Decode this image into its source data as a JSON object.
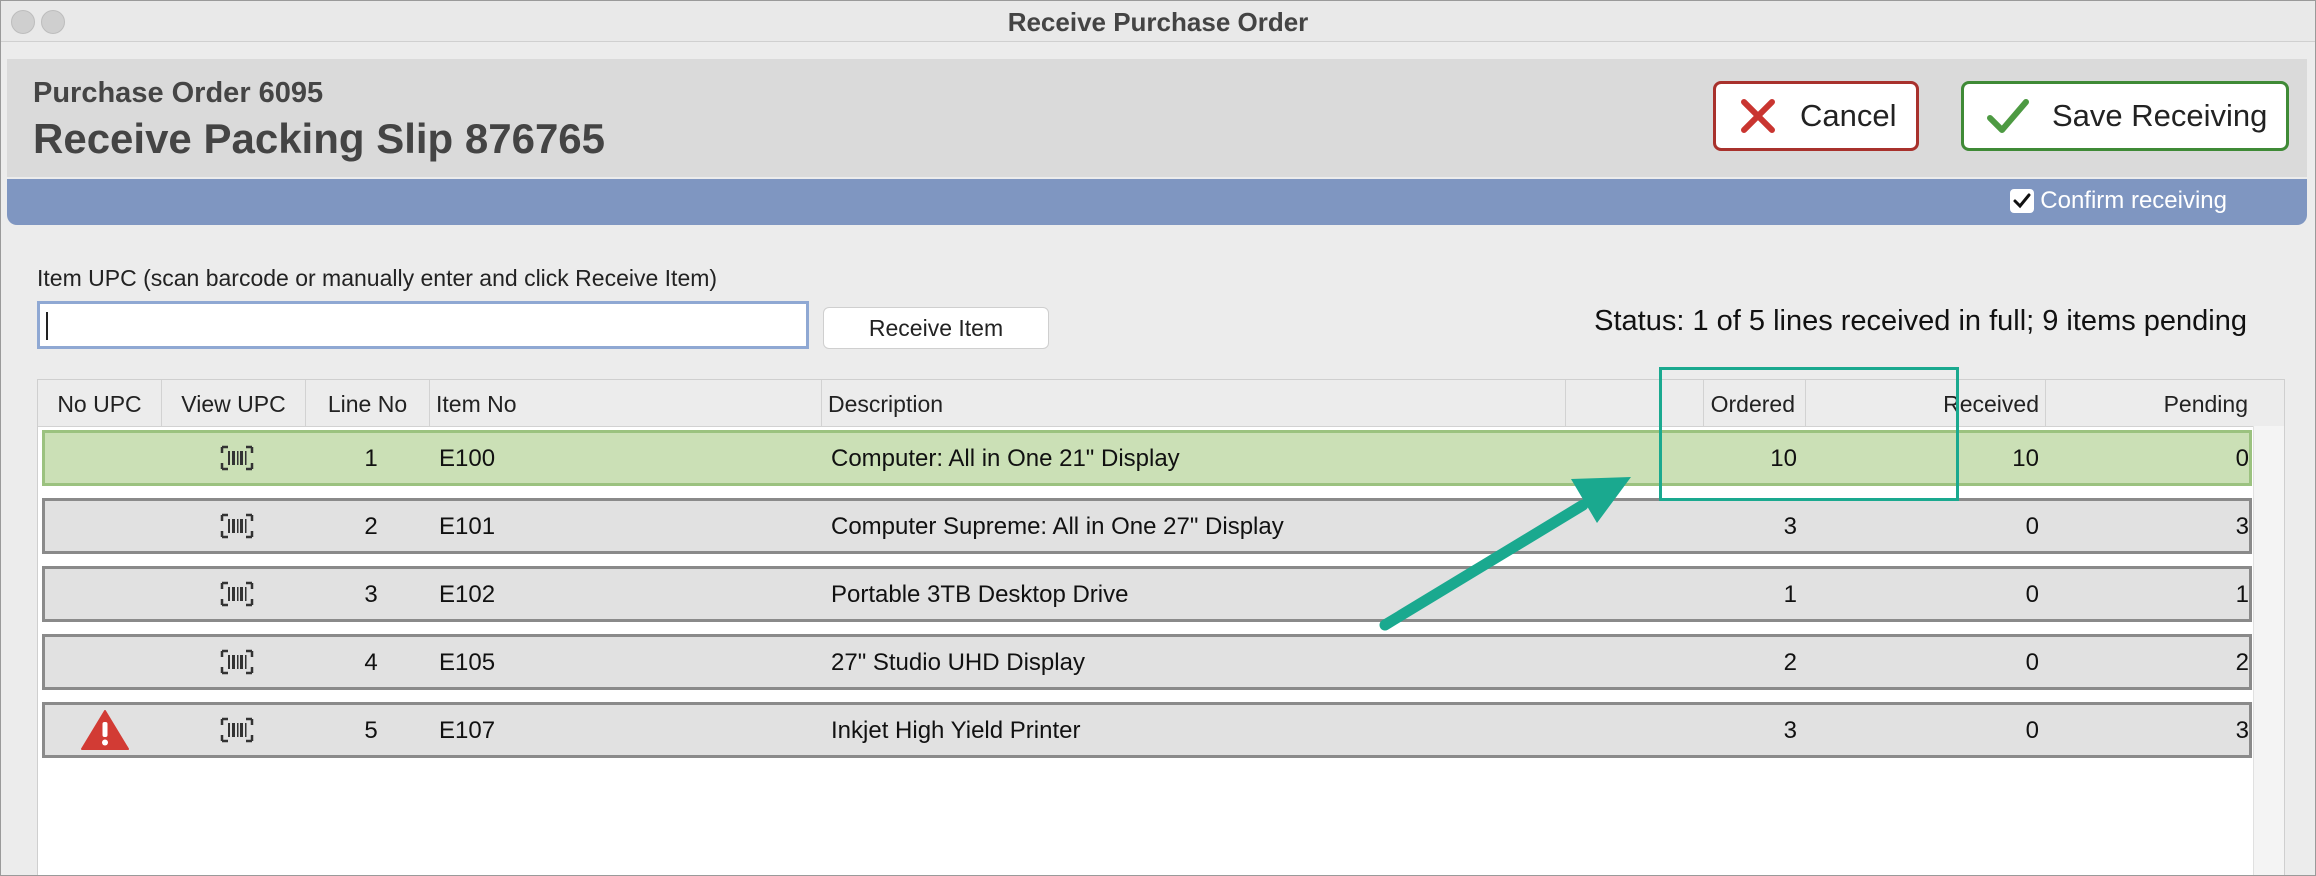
{
  "window": {
    "title": "Receive Purchase Order"
  },
  "header": {
    "po_title": "Purchase Order 6095",
    "slip_title": "Receive Packing Slip 876765",
    "cancel_label": "Cancel",
    "save_label": "Save Receiving",
    "confirm_label": "Confirm receiving",
    "confirm_checked": true
  },
  "upc": {
    "label": "Item UPC (scan barcode or manually enter and click Receive Item)",
    "value": "",
    "receive_button": "Receive Item"
  },
  "status": "Status: 1 of 5 lines received in full; 9 items pending",
  "columns": [
    "No UPC",
    "View UPC",
    "Line No",
    "Item No",
    "Description",
    "Ordered",
    "Received",
    "Pending"
  ],
  "rows": [
    {
      "line": "1",
      "item": "E100",
      "description": "Computer: All in One 21\" Display",
      "ordered": "10",
      "received": "10",
      "pending": "0",
      "no_upc_warning": false,
      "complete": true
    },
    {
      "line": "2",
      "item": "E101",
      "description": "Computer Supreme: All in One 27\" Display",
      "ordered": "3",
      "received": "0",
      "pending": "3",
      "no_upc_warning": false,
      "complete": false
    },
    {
      "line": "3",
      "item": "E102",
      "description": "Portable 3TB Desktop Drive",
      "ordered": "1",
      "received": "0",
      "pending": "1",
      "no_upc_warning": false,
      "complete": false
    },
    {
      "line": "4",
      "item": "E105",
      "description": "27\" Studio UHD Display",
      "ordered": "2",
      "received": "0",
      "pending": "2",
      "no_upc_warning": false,
      "complete": false
    },
    {
      "line": "5",
      "item": "E107",
      "description": "Inkjet High Yield Printer",
      "ordered": "3",
      "received": "0",
      "pending": "3",
      "no_upc_warning": true,
      "complete": false
    }
  ],
  "colors": {
    "complete_row": "#cbe0b6",
    "pending_row": "#e1e1e1",
    "header_band": "#7f96c1",
    "cancel_accent": "#a8312c",
    "save_accent": "#3f8a36",
    "annotation": "#1aa98f",
    "warning": "#d23b34"
  },
  "icons": {
    "cancel": "x-icon",
    "save": "checkmark-icon",
    "view_upc": "barcode-icon",
    "no_upc": "warning-triangle-icon"
  }
}
